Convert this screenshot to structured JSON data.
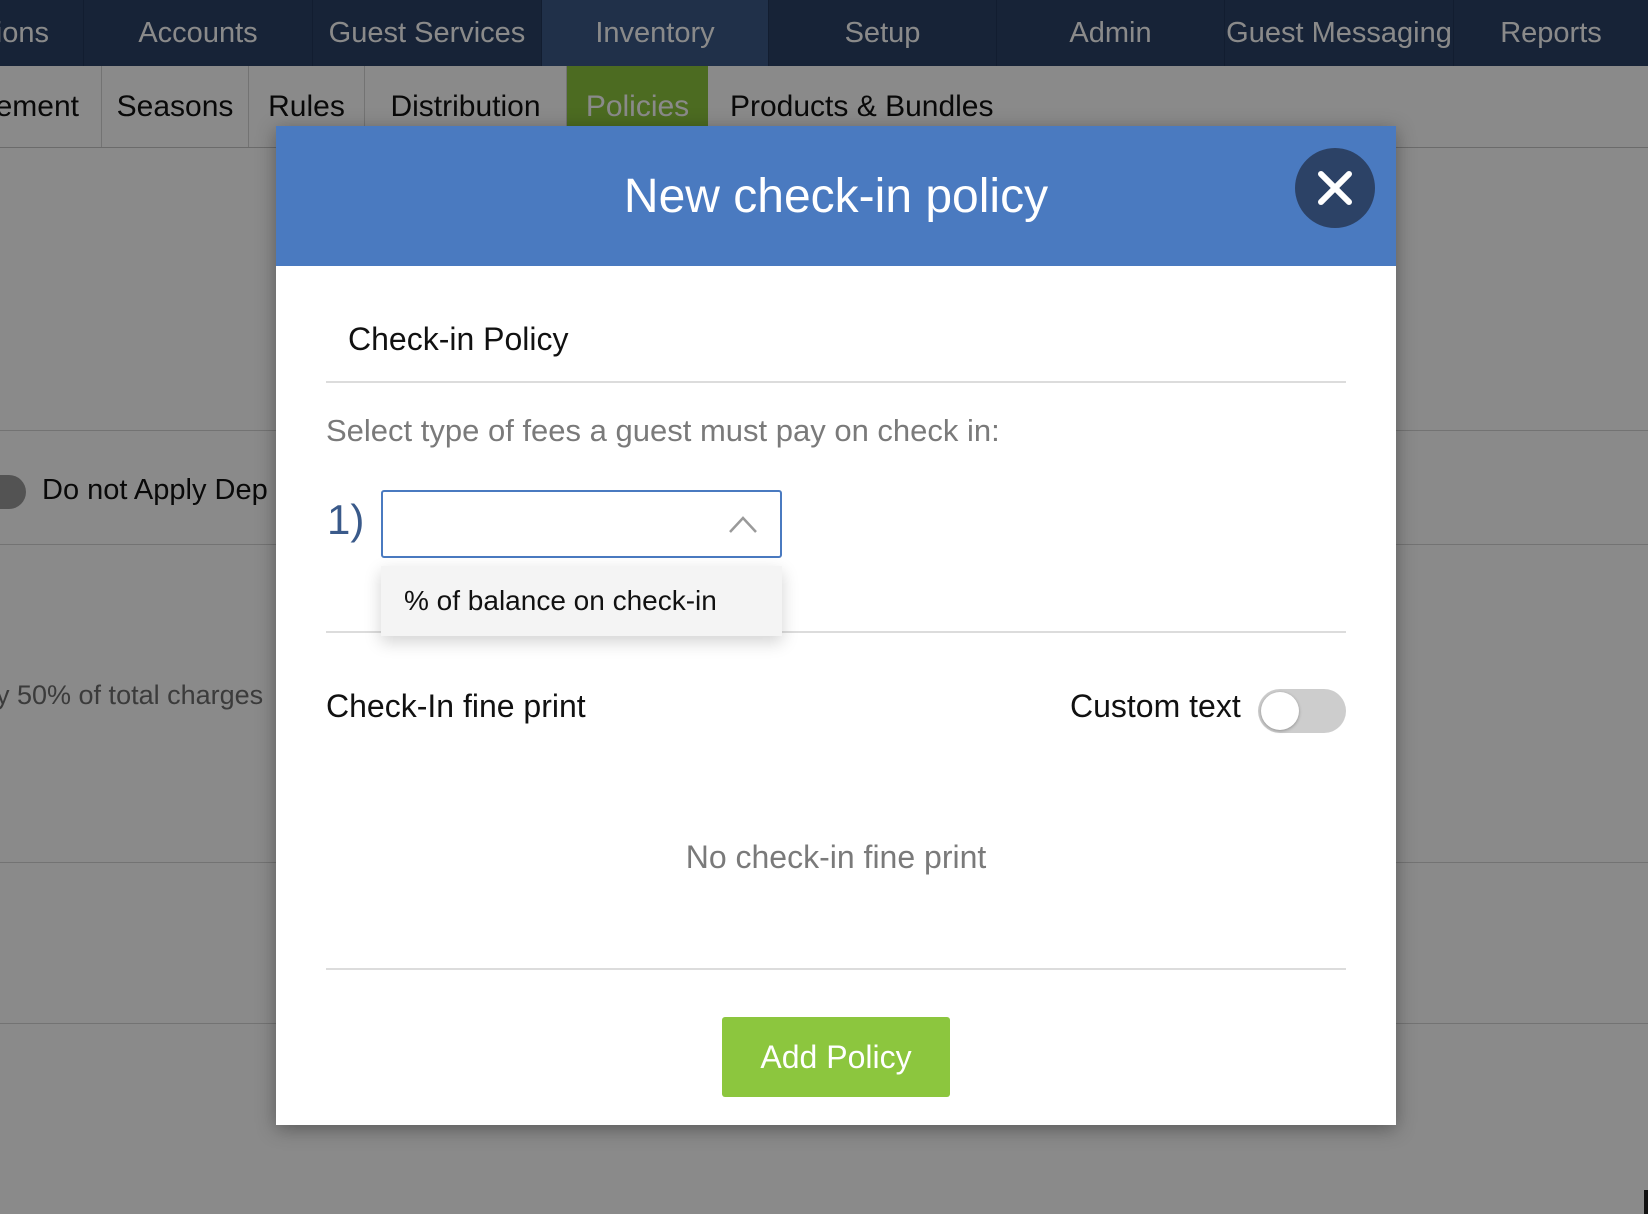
{
  "top_nav": {
    "items": [
      {
        "label": "ions"
      },
      {
        "label": "Accounts"
      },
      {
        "label": "Guest Services"
      },
      {
        "label": "Inventory"
      },
      {
        "label": "Setup"
      },
      {
        "label": "Admin"
      },
      {
        "label": "Guest Messaging"
      },
      {
        "label": "Reports"
      }
    ],
    "active": "Inventory"
  },
  "sub_nav": {
    "items": [
      {
        "label": "ement"
      },
      {
        "label": "Seasons"
      },
      {
        "label": "Rules"
      },
      {
        "label": "Distribution"
      },
      {
        "label": "Policies"
      },
      {
        "label": "Products & Bundles"
      }
    ],
    "active": "Policies"
  },
  "background": {
    "toggle_label": "Do not Apply Dep",
    "charges_text": "y 50% of total charges"
  },
  "modal": {
    "title": "New check-in policy",
    "close_icon": "close-icon",
    "section_title": "Check-in Policy",
    "prompt": "Select type of fees a guest must pay on check in:",
    "fee_index_label": "1)",
    "fee_select_value": "",
    "dropdown_options": [
      "% of balance on check-in"
    ],
    "fine_print_title": "Check-In fine print",
    "custom_text_label": "Custom text",
    "custom_text_enabled": false,
    "fine_print_empty": "No check-in fine print",
    "add_button_label": "Add Policy"
  },
  "colors": {
    "nav_bg": "#2c4266",
    "modal_header": "#4a7ac0",
    "accent_green": "#8cc63e"
  }
}
